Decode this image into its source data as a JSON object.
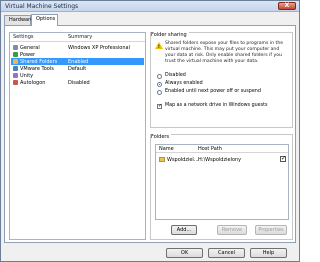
{
  "window": {
    "title": "Virtual Machine Settings",
    "close_glyph": "X"
  },
  "tabs": [
    {
      "label": "Hardware",
      "active": false
    },
    {
      "label": "Options",
      "active": true
    }
  ],
  "settings_list": {
    "col_settings": "Settings",
    "col_summary": "Summary",
    "rows": [
      {
        "label": "General",
        "summary": "Windows XP Professional",
        "icon": "general-icon"
      },
      {
        "label": "Power",
        "summary": "",
        "icon": "power-icon"
      },
      {
        "label": "Shared Folders",
        "summary": "Enabled",
        "icon": "shared-folders-icon",
        "selected": true
      },
      {
        "label": "VMware Tools",
        "summary": "Default",
        "icon": "vmware-tools-icon"
      },
      {
        "label": "Unity",
        "summary": "",
        "icon": "unity-icon"
      },
      {
        "label": "Autologon",
        "summary": "Disabled",
        "icon": "autologon-icon"
      }
    ]
  },
  "folder_sharing": {
    "title": "Folder sharing",
    "warning": "Shared folders expose your files to programs in the virtual machine. This may put your computer and your data at risk. Only enable shared folders if you trust the virtual machine with your data.",
    "options": [
      {
        "label": "Disabled",
        "selected": false
      },
      {
        "label": "Always enabled",
        "selected": true
      },
      {
        "label": "Enabled until next power off or suspend",
        "selected": false
      }
    ],
    "map_drive_label": "Map as a network drive in Windows guests",
    "map_drive_checked": true
  },
  "folders": {
    "title": "Folders",
    "col_name": "Name",
    "col_host_path": "Host Path",
    "rows": [
      {
        "name": "Wspoldziel...",
        "host_path": "H:\\Wspoldzielony",
        "enabled": true
      }
    ],
    "add_label": "Add...",
    "remove_label": "Remove",
    "properties_label": "Properties"
  },
  "footer": {
    "ok_label": "OK",
    "cancel_label": "Cancel",
    "help_label": "Help"
  },
  "colors": {
    "selection": "#3399ff",
    "warning": "#f2c200"
  }
}
